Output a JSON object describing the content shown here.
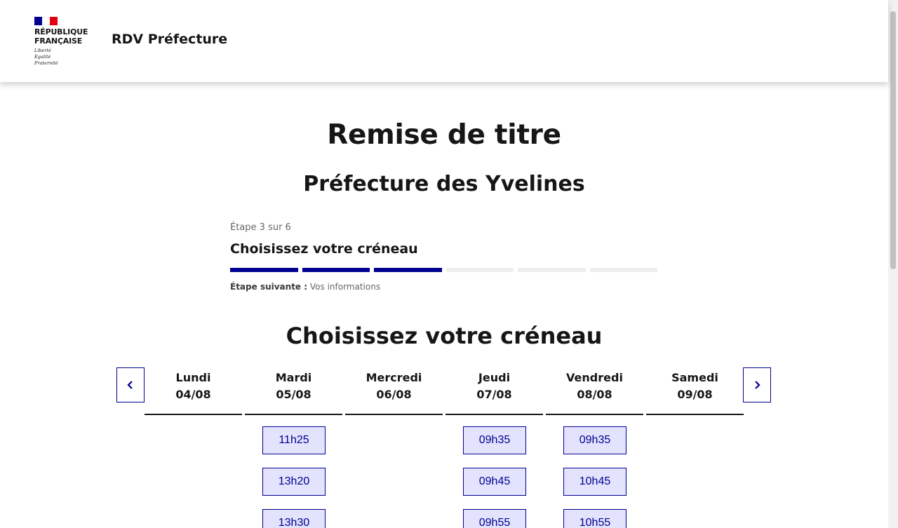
{
  "header": {
    "logo_line1": "RÉPUBLIQUE",
    "logo_line2": "FRANÇAISE",
    "motto": [
      "Liberté",
      "Égalité",
      "Fraternité"
    ],
    "service_name": "RDV Préfecture"
  },
  "main": {
    "title": "Remise de titre",
    "subtitle": "Préfecture des Yvelines"
  },
  "stepper": {
    "step_count": "Étape 3 sur 6",
    "current_title": "Choisissez votre créneau",
    "total_steps": 6,
    "completed_steps": 3,
    "next_label": "Étape suivante :",
    "next_value": "Vos informations"
  },
  "slots_section": {
    "title": "Choisissez votre créneau",
    "prev_icon": "chevron-left-icon",
    "next_icon": "chevron-right-icon",
    "days": [
      {
        "name": "Lundi",
        "date": "04/08",
        "slots": []
      },
      {
        "name": "Mardi",
        "date": "05/08",
        "slots": [
          "11h25",
          "13h20",
          "13h30"
        ]
      },
      {
        "name": "Mercredi",
        "date": "06/08",
        "slots": []
      },
      {
        "name": "Jeudi",
        "date": "07/08",
        "slots": [
          "09h35",
          "09h45",
          "09h55"
        ]
      },
      {
        "name": "Vendredi",
        "date": "08/08",
        "slots": [
          "09h35",
          "10h45",
          "10h55"
        ]
      },
      {
        "name": "Samedi",
        "date": "09/08",
        "slots": []
      }
    ]
  },
  "colors": {
    "primary": "#000091",
    "slot_background": "#e3e3fd",
    "flag_red": "#e1000f"
  }
}
